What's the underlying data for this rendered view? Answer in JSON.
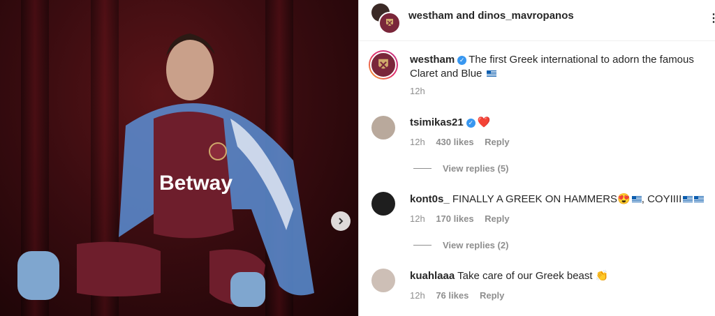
{
  "header": {
    "title": "westham and dinos_mavropanos",
    "more": "⋮"
  },
  "caption": {
    "username": "westham",
    "text": "The first Greek international to adorn the famous",
    "text2": "Claret and Blue",
    "time": "12h"
  },
  "comments": [
    {
      "username": "tsimikas21",
      "text": "",
      "emoji": "❤️",
      "time": "12h",
      "likes": "430 likes",
      "reply": "Reply",
      "view_replies": "View replies (5)"
    },
    {
      "username": "kont0s_",
      "text": "FINALLY A GREEK ON HAMMERS😍",
      "text_mid": ", COYIIII",
      "time": "12h",
      "likes": "170 likes",
      "reply": "Reply",
      "view_replies": "View replies (2)"
    },
    {
      "username": "kuahlaaa",
      "text": "Take care of our Greek beast",
      "emoji": "👏",
      "time": "12h",
      "likes": "76 likes",
      "reply": "Reply"
    }
  ],
  "photo": {
    "sponsor_text": "Betway"
  },
  "colors": {
    "claret": "#7a263a",
    "blue": "#3897f0",
    "gray": "#8e8e8e"
  },
  "icons": [
    "chevron-right-icon",
    "verified-badge-icon",
    "greek-flag-icon",
    "west-ham-crest-icon"
  ]
}
